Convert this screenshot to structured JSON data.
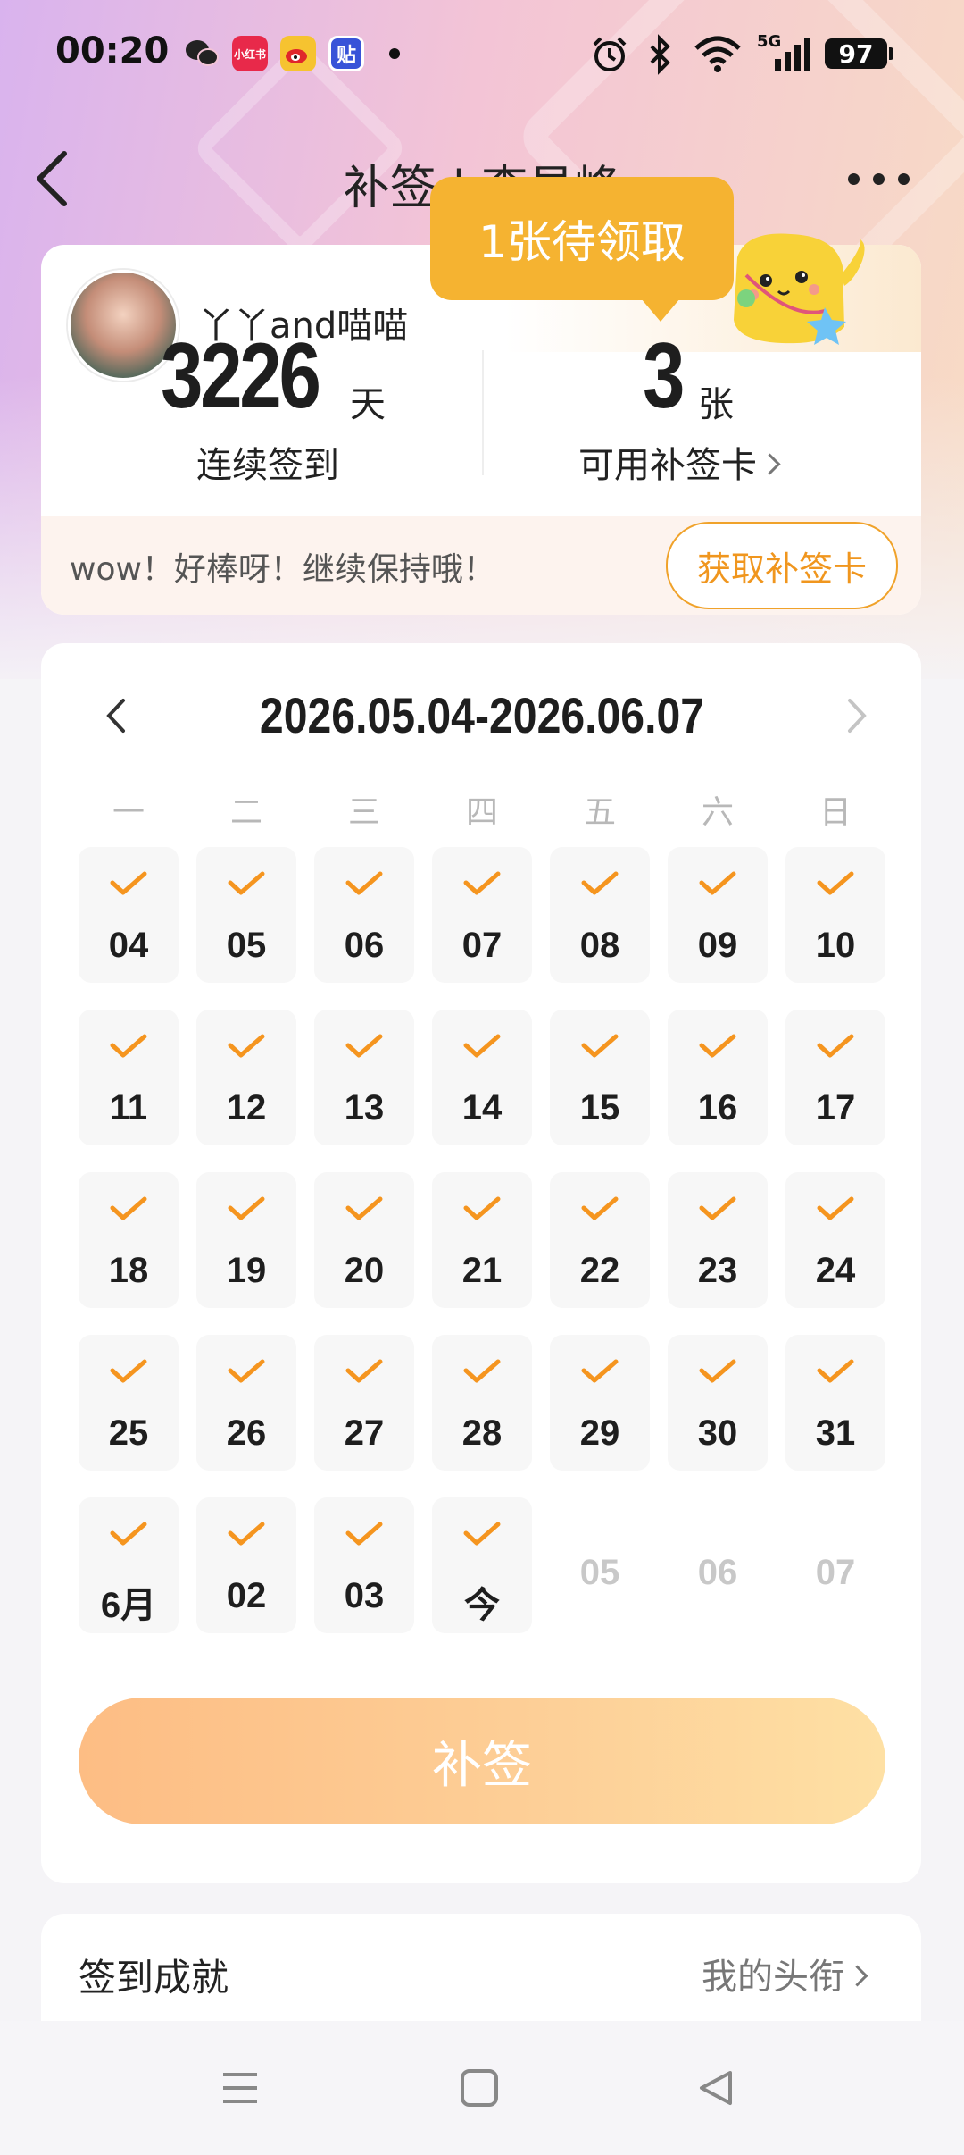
{
  "status_bar": {
    "time": "00:20",
    "notification_icons": [
      "wechat-icon",
      "xiaohongshu-icon",
      "weibo-icon",
      "tieba-icon"
    ],
    "xiaohongshu_label": "小红书",
    "tieba_label": "贴",
    "network": "5G",
    "battery": "97"
  },
  "nav": {
    "title": "补签 | 李易峰"
  },
  "summary": {
    "username": "丫丫and喵喵",
    "streak_days": "3226",
    "streak_unit": "天",
    "streak_label": "连续签到",
    "cards_count": "3",
    "cards_unit": "张",
    "cards_label": "可用补签卡",
    "bubble_text": "1张待领取",
    "tip_text": "wow！好棒呀！继续保持哦！",
    "get_card_button": "获取补签卡"
  },
  "calendar": {
    "range": "2026.05.04-2026.06.07",
    "weekdays": [
      "一",
      "二",
      "三",
      "四",
      "五",
      "六",
      "日"
    ],
    "days": [
      {
        "label": "04",
        "checked": true
      },
      {
        "label": "05",
        "checked": true
      },
      {
        "label": "06",
        "checked": true
      },
      {
        "label": "07",
        "checked": true
      },
      {
        "label": "08",
        "checked": true
      },
      {
        "label": "09",
        "checked": true
      },
      {
        "label": "10",
        "checked": true
      },
      {
        "label": "11",
        "checked": true
      },
      {
        "label": "12",
        "checked": true
      },
      {
        "label": "13",
        "checked": true
      },
      {
        "label": "14",
        "checked": true
      },
      {
        "label": "15",
        "checked": true
      },
      {
        "label": "16",
        "checked": true
      },
      {
        "label": "17",
        "checked": true
      },
      {
        "label": "18",
        "checked": true
      },
      {
        "label": "19",
        "checked": true
      },
      {
        "label": "20",
        "checked": true
      },
      {
        "label": "21",
        "checked": true
      },
      {
        "label": "22",
        "checked": true
      },
      {
        "label": "23",
        "checked": true
      },
      {
        "label": "24",
        "checked": true
      },
      {
        "label": "25",
        "checked": true
      },
      {
        "label": "26",
        "checked": true
      },
      {
        "label": "27",
        "checked": true
      },
      {
        "label": "28",
        "checked": true
      },
      {
        "label": "29",
        "checked": true
      },
      {
        "label": "30",
        "checked": true
      },
      {
        "label": "31",
        "checked": true
      },
      {
        "label": "6月",
        "checked": true
      },
      {
        "label": "02",
        "checked": true
      },
      {
        "label": "03",
        "checked": true
      },
      {
        "label": "今",
        "checked": true
      },
      {
        "label": "05",
        "checked": false
      },
      {
        "label": "06",
        "checked": false
      },
      {
        "label": "07",
        "checked": false
      }
    ],
    "sign_button": "补签"
  },
  "achievement": {
    "title": "签到成就",
    "link": "我的头衔"
  },
  "colors": {
    "accent_orange": "#f5951f",
    "bubble": "#f5b331",
    "future_day": "#c8c8c8"
  }
}
